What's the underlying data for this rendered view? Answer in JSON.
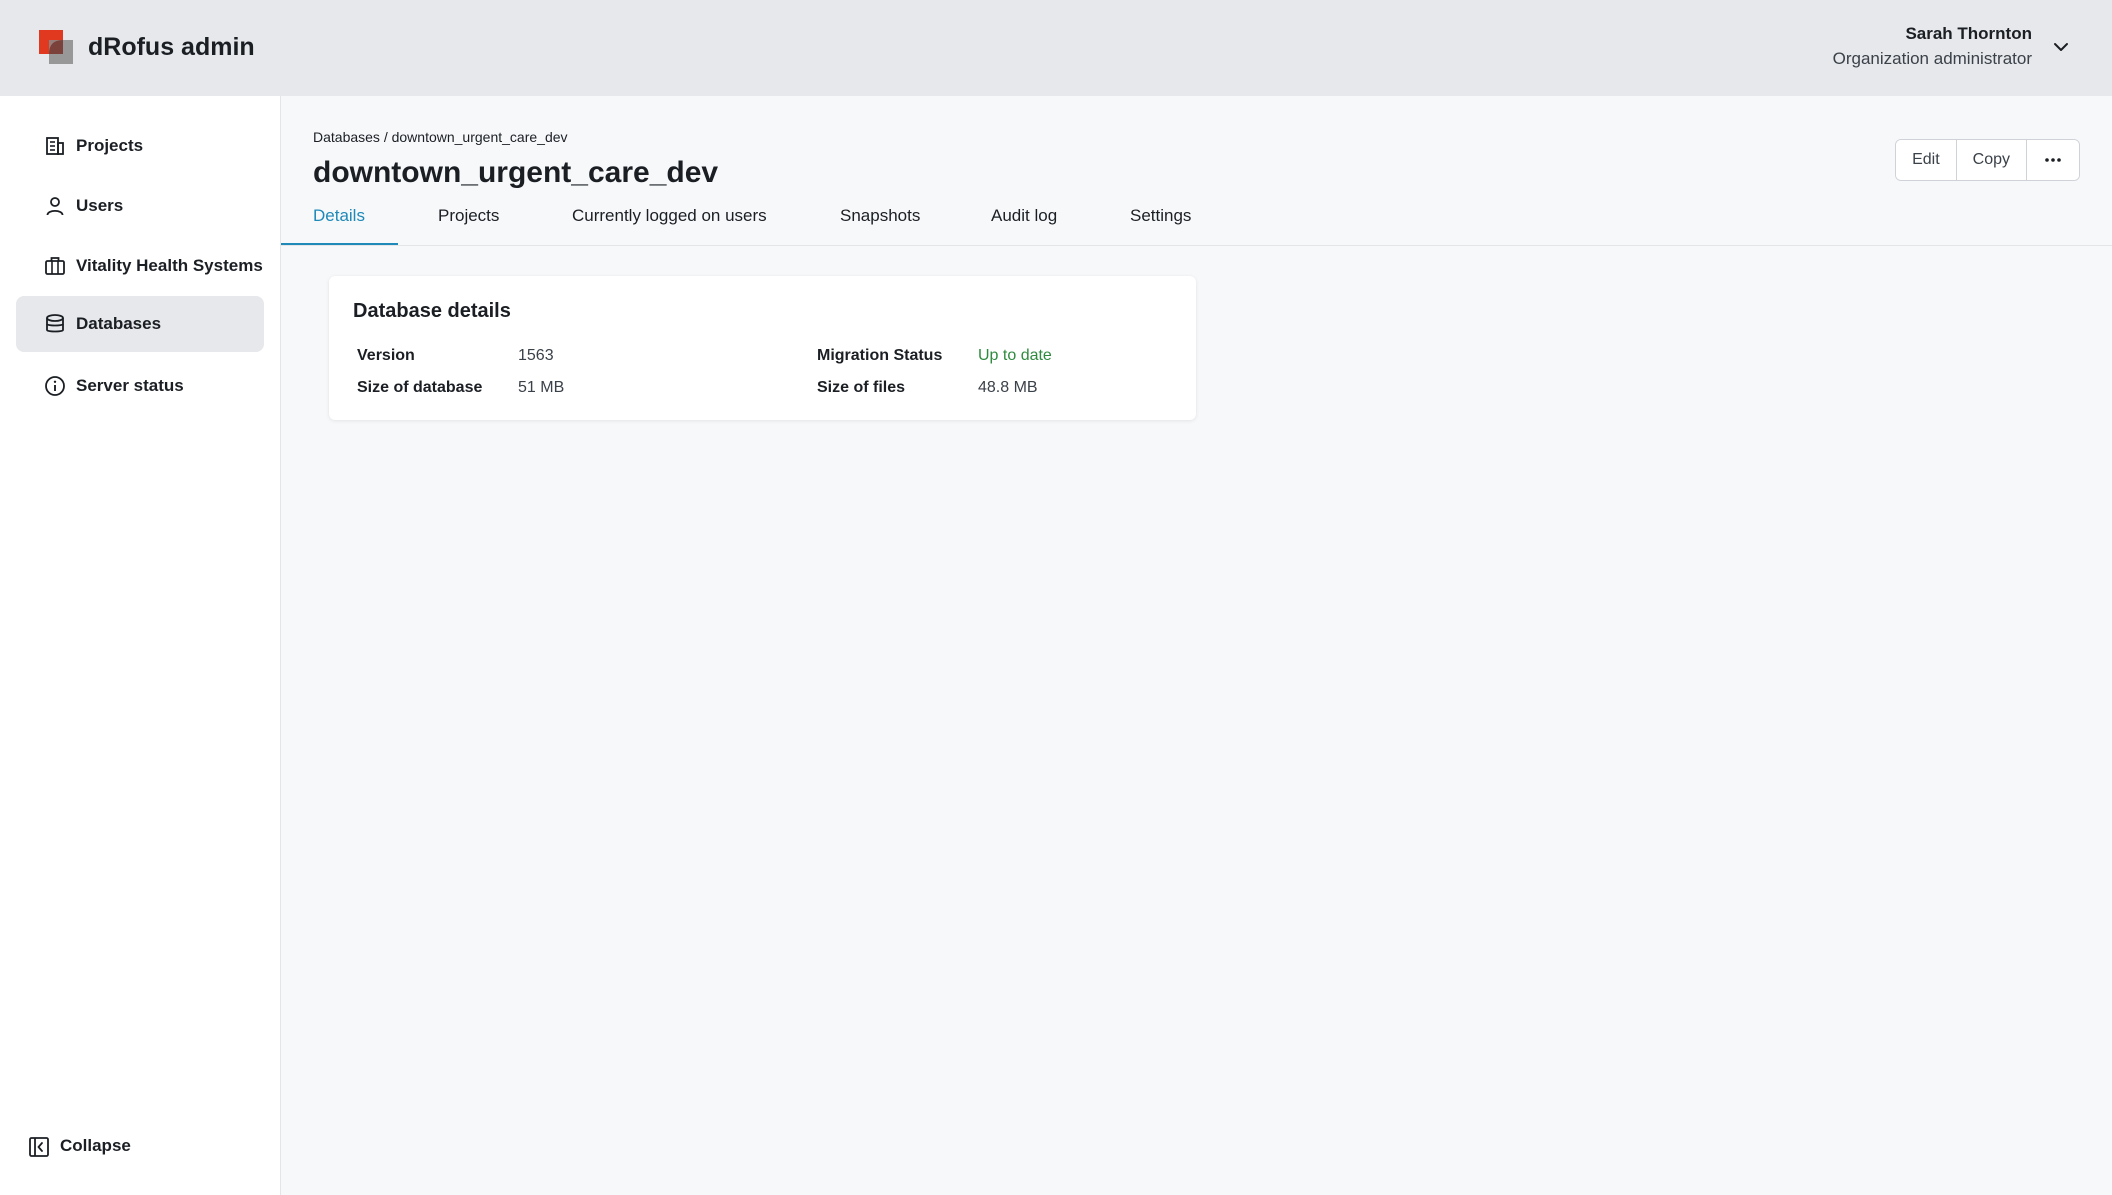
{
  "app": {
    "title": "dRofus admin",
    "logo_icon": "drofus-logo-icon",
    "colors": {
      "brand_red": "#e0391f",
      "brand_grey": "#8a8a8a",
      "accent": "#1f89b8",
      "success": "#2e8b3e"
    }
  },
  "user": {
    "name": "Sarah Thornton",
    "role": "Organization administrator",
    "menu_icon": "chevron-down-icon"
  },
  "sidebar": {
    "items": [
      {
        "label": "Projects",
        "icon": "building-icon",
        "active": false
      },
      {
        "label": "Users",
        "icon": "user-icon",
        "active": false
      },
      {
        "label": "Vitality Health Systems",
        "icon": "briefcase-icon",
        "active": false
      },
      {
        "label": "Databases",
        "icon": "database-icon",
        "active": true
      },
      {
        "label": "Server status",
        "icon": "info-icon",
        "active": false
      }
    ],
    "collapse_label": "Collapse",
    "collapse_icon": "collapse-sidebar-icon"
  },
  "breadcrumb": {
    "parent": "Databases",
    "separator": " / ",
    "current": "downtown_urgent_care_dev"
  },
  "page": {
    "title": "downtown_urgent_care_dev"
  },
  "actions": {
    "edit_label": "Edit",
    "copy_label": "Copy",
    "more_icon": "more-horizontal-icon"
  },
  "tabs": [
    {
      "label": "Details",
      "active": true
    },
    {
      "label": "Projects",
      "active": false
    },
    {
      "label": "Currently logged on users",
      "active": false
    },
    {
      "label": "Snapshots",
      "active": false
    },
    {
      "label": "Audit log",
      "active": false
    },
    {
      "label": "Settings",
      "active": false
    }
  ],
  "details_card": {
    "title": "Database details",
    "fields": [
      {
        "label": "Version",
        "value": "1563"
      },
      {
        "label": "Migration Status",
        "value": "Up to date"
      },
      {
        "label": "Size of database",
        "value": "51 MB"
      },
      {
        "label": "Size of files",
        "value": "48.8 MB"
      }
    ]
  }
}
